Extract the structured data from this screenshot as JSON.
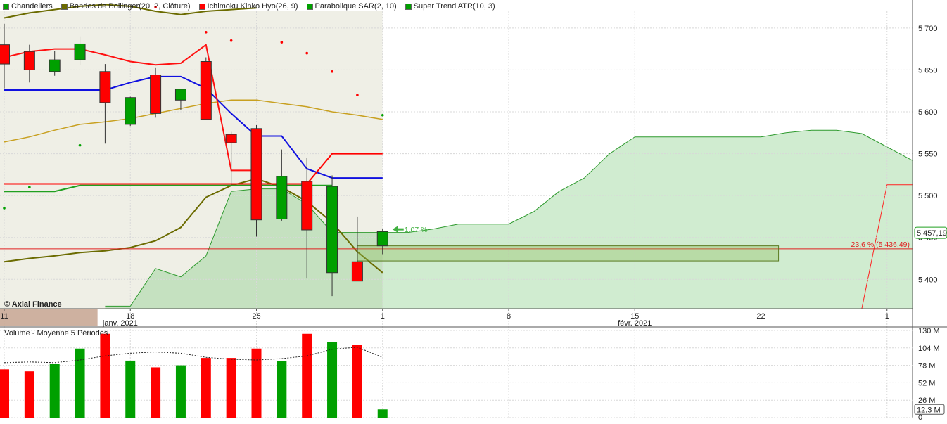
{
  "legend": [
    {
      "label": "Chandeliers",
      "color": "#00a000"
    },
    {
      "label": "Bandes de Bollinger(20, 2, Clôture)",
      "color": "#6b6b00"
    },
    {
      "label": "Ichimoku Kinko Hyo(26, 9)",
      "color": "#ff0000"
    },
    {
      "label": "Parabolique SAR(2, 10)",
      "color": "#00a000"
    },
    {
      "label": "Super Trend ATR(10, 3)",
      "color": "#00a000"
    }
  ],
  "watermark": "© Axial Finance",
  "volume_legend": "Volume  - Moyenne 5 Périodes",
  "chart_data": [
    {
      "type": "candlestick",
      "title": "",
      "price_ticks": [
        "5 700",
        "5 650",
        "5 600",
        "5 550",
        "5 500",
        "5 450",
        "5 400"
      ],
      "date_ticks": [
        {
          "label": "11",
          "slot": 0
        },
        {
          "label": "18",
          "slot": 5
        },
        {
          "label": "25",
          "slot": 10
        },
        {
          "label": "1",
          "slot": 15
        },
        {
          "label": "8",
          "slot": 20
        },
        {
          "label": "15",
          "slot": 25
        },
        {
          "label": "22",
          "slot": 30
        },
        {
          "label": "1",
          "slot": 35
        }
      ],
      "month_labels": [
        {
          "label": "janv. 2021",
          "slot": 4.6
        },
        {
          "label": "févr. 2021",
          "slot": 25.0
        }
      ],
      "ylim": [
        5365,
        5720
      ],
      "last_price_label": "5 457,19",
      "last_price": 5457.19,
      "change_label": "1,07 %",
      "fib_label": "23,6 % (5 436,49)",
      "fib_level": 5436.49,
      "candles": [
        {
          "slot": 0,
          "open": 5680,
          "high": 5705,
          "low": 5628,
          "close": 5657
        },
        {
          "slot": 1,
          "open": 5672,
          "high": 5680,
          "low": 5635,
          "close": 5650
        },
        {
          "slot": 2,
          "open": 5648,
          "high": 5673,
          "low": 5643,
          "close": 5662
        },
        {
          "slot": 3,
          "open": 5662,
          "high": 5690,
          "low": 5656,
          "close": 5681
        },
        {
          "slot": 4,
          "open": 5648,
          "high": 5657,
          "low": 5562,
          "close": 5611
        },
        {
          "slot": 5,
          "open": 5585,
          "high": 5618,
          "low": 5583,
          "close": 5617
        },
        {
          "slot": 6,
          "open": 5644,
          "high": 5653,
          "low": 5593,
          "close": 5598
        },
        {
          "slot": 7,
          "open": 5614,
          "high": 5625,
          "low": 5602,
          "close": 5627
        },
        {
          "slot": 8,
          "open": 5660,
          "high": 5665,
          "low": 5590,
          "close": 5591
        },
        {
          "slot": 9,
          "open": 5573,
          "high": 5576,
          "low": 5511,
          "close": 5563
        },
        {
          "slot": 10,
          "open": 5580,
          "high": 5584,
          "low": 5451,
          "close": 5471
        },
        {
          "slot": 11,
          "open": 5472,
          "high": 5555,
          "low": 5470,
          "close": 5523
        },
        {
          "slot": 12,
          "open": 5517,
          "high": 5545,
          "low": 5401,
          "close": 5459
        },
        {
          "slot": 13,
          "open": 5408,
          "high": 5524,
          "low": 5380,
          "close": 5511
        },
        {
          "slot": 14,
          "open": 5421,
          "high": 5475,
          "low": 5398,
          "close": 5398
        },
        {
          "slot": 15,
          "open": 5440,
          "high": 5460,
          "low": 5430,
          "close": 5457
        }
      ],
      "bollinger": {
        "upper": [
          [
            0,
            5712
          ],
          [
            1,
            5718
          ],
          [
            2,
            5722
          ],
          [
            3,
            5726
          ],
          [
            4,
            5728
          ],
          [
            5,
            5726
          ],
          [
            6,
            5720
          ],
          [
            7,
            5716
          ],
          [
            8,
            5720
          ],
          [
            9,
            5722
          ],
          [
            10,
            5724
          ]
        ],
        "middle": [
          [
            0,
            5564
          ],
          [
            1,
            5570
          ],
          [
            2,
            5578
          ],
          [
            3,
            5585
          ],
          [
            4,
            5588
          ],
          [
            5,
            5592
          ],
          [
            6,
            5598
          ],
          [
            7,
            5604
          ],
          [
            8,
            5610
          ],
          [
            9,
            5614
          ],
          [
            10,
            5614
          ],
          [
            11,
            5610
          ],
          [
            12,
            5606
          ],
          [
            13,
            5600
          ],
          [
            14,
            5596
          ],
          [
            15,
            5591
          ]
        ],
        "lower": [
          [
            0,
            5421
          ],
          [
            1,
            5425
          ],
          [
            2,
            5428
          ],
          [
            3,
            5432
          ],
          [
            4,
            5434
          ],
          [
            5,
            5438
          ],
          [
            6,
            5446
          ],
          [
            7,
            5462
          ],
          [
            8,
            5498
          ],
          [
            9,
            5512
          ],
          [
            10,
            5520
          ],
          [
            11,
            5510
          ],
          [
            12,
            5493
          ],
          [
            13,
            5468
          ],
          [
            14,
            5433
          ],
          [
            15,
            5408
          ]
        ]
      },
      "ichimoku": {
        "tenkan": [
          [
            0,
            5626
          ],
          [
            1,
            5626
          ],
          [
            2,
            5626
          ],
          [
            3,
            5626
          ],
          [
            4,
            5626
          ],
          [
            5,
            5635
          ],
          [
            6,
            5642
          ],
          [
            7,
            5642
          ],
          [
            8,
            5628
          ],
          [
            9,
            5598
          ],
          [
            10,
            5571
          ],
          [
            11,
            5571
          ],
          [
            12,
            5532
          ],
          [
            13,
            5521
          ],
          [
            14,
            5521
          ],
          [
            15,
            5521
          ]
        ],
        "kijun": [
          [
            0,
            5514
          ],
          [
            1,
            5514
          ],
          [
            2,
            5514
          ],
          [
            3,
            5514
          ],
          [
            4,
            5514
          ],
          [
            5,
            5514
          ],
          [
            6,
            5514
          ],
          [
            7,
            5514
          ],
          [
            8,
            5514
          ],
          [
            9,
            5514
          ],
          [
            10,
            5514
          ],
          [
            11,
            5514
          ],
          [
            12,
            5514
          ],
          [
            13,
            5550
          ],
          [
            14,
            5550
          ],
          [
            15,
            5550
          ]
        ],
        "cloud_top": [
          [
            4,
            5368
          ],
          [
            5,
            5368
          ],
          [
            6,
            5413
          ],
          [
            7,
            5403
          ],
          [
            8,
            5428
          ],
          [
            9,
            5505
          ],
          [
            10,
            5508
          ],
          [
            11,
            5508
          ],
          [
            12,
            5490
          ],
          [
            13,
            5456
          ],
          [
            14,
            5456
          ],
          [
            15,
            5456
          ],
          [
            16,
            5456
          ],
          [
            17,
            5460
          ],
          [
            18,
            5466
          ],
          [
            19,
            5466
          ],
          [
            20,
            5466
          ],
          [
            21,
            5481
          ],
          [
            22,
            5505
          ],
          [
            23,
            5521
          ],
          [
            24,
            5550
          ],
          [
            25,
            5570
          ],
          [
            26,
            5570
          ],
          [
            27,
            5570
          ],
          [
            28,
            5570
          ],
          [
            29,
            5570
          ],
          [
            30,
            5570
          ],
          [
            31,
            5575
          ],
          [
            32,
            5578
          ],
          [
            33,
            5578
          ],
          [
            34,
            5574
          ],
          [
            35,
            5558
          ],
          [
            36,
            5542
          ]
        ],
        "cloud_bottom": 5365,
        "chikou": [
          [
            0,
            5665
          ],
          [
            1,
            5672
          ],
          [
            2,
            5675
          ],
          [
            3,
            5675
          ],
          [
            4,
            5668
          ],
          [
            5,
            5660
          ],
          [
            6,
            5656
          ],
          [
            7,
            5658
          ],
          [
            8,
            5680
          ],
          [
            9,
            5530
          ],
          [
            10,
            5530
          ]
        ],
        "kumo_bottom_red": [
          [
            33,
            5365
          ],
          [
            34,
            5365
          ],
          [
            35,
            5513
          ],
          [
            36,
            5513
          ]
        ]
      },
      "sar": [
        [
          0,
          5485
        ],
        [
          1,
          5510
        ],
        [
          3,
          5560
        ],
        [
          6,
          5725
        ],
        [
          8,
          5695
        ],
        [
          9,
          5685
        ],
        [
          11,
          5683
        ],
        [
          12,
          5670
        ],
        [
          13,
          5648
        ],
        [
          14,
          5620
        ],
        [
          15,
          5596
        ]
      ],
      "supertrend": [
        [
          0,
          5505
        ],
        [
          1,
          5505
        ],
        [
          2,
          5505
        ],
        [
          3,
          5512
        ],
        [
          4,
          5512
        ],
        [
          5,
          5512
        ],
        [
          6,
          5512
        ],
        [
          7,
          5512
        ],
        [
          8,
          5512
        ],
        [
          9,
          5512
        ],
        [
          10,
          5512
        ],
        [
          11,
          5512
        ],
        [
          12,
          5512
        ],
        [
          13,
          5512
        ]
      ],
      "rectangle": {
        "x1": 14,
        "x2": 30.7,
        "y1": 5440,
        "y2": 5422
      }
    },
    {
      "type": "bar",
      "title": "",
      "series_label": "Volume",
      "volume_ticks": [
        "130 M",
        "104 M",
        "78 M",
        "52 M",
        "26 M",
        "0"
      ],
      "ylim": [
        0,
        130
      ],
      "last_volume_label": "12,3 M",
      "volumes": [
        {
          "slot": 0,
          "value": 72,
          "up": false
        },
        {
          "slot": 1,
          "value": 69,
          "up": false
        },
        {
          "slot": 2,
          "value": 80,
          "up": true
        },
        {
          "slot": 3,
          "value": 103,
          "up": true
        },
        {
          "slot": 4,
          "value": 125,
          "up": false
        },
        {
          "slot": 5,
          "value": 85,
          "up": true
        },
        {
          "slot": 6,
          "value": 75,
          "up": false
        },
        {
          "slot": 7,
          "value": 78,
          "up": true
        },
        {
          "slot": 8,
          "value": 89,
          "up": false
        },
        {
          "slot": 9,
          "value": 89,
          "up": false
        },
        {
          "slot": 10,
          "value": 103,
          "up": false
        },
        {
          "slot": 11,
          "value": 84,
          "up": true
        },
        {
          "slot": 12,
          "value": 125,
          "up": false
        },
        {
          "slot": 13,
          "value": 113,
          "up": true
        },
        {
          "slot": 14,
          "value": 109,
          "up": false
        },
        {
          "slot": 15,
          "value": 12.3,
          "up": true
        }
      ],
      "moving_average": [
        [
          0,
          82
        ],
        [
          1,
          83
        ],
        [
          2,
          82
        ],
        [
          3,
          86
        ],
        [
          4,
          92
        ],
        [
          5,
          96
        ],
        [
          6,
          98
        ],
        [
          7,
          96
        ],
        [
          8,
          90
        ],
        [
          9,
          87
        ],
        [
          10,
          86
        ],
        [
          11,
          88
        ],
        [
          12,
          92
        ],
        [
          13,
          102
        ],
        [
          14,
          105
        ],
        [
          15,
          90
        ]
      ]
    }
  ]
}
